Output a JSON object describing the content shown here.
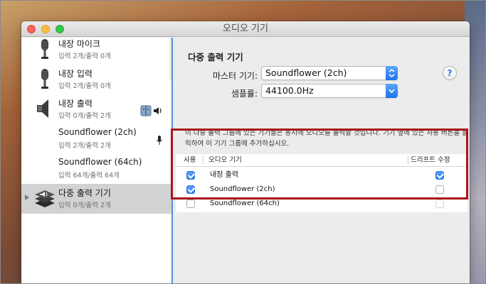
{
  "window": {
    "title": "오디오 기기"
  },
  "sidebar": {
    "devices": [
      {
        "name": "내장 마이크",
        "sub": "입력 2개/출력 0개",
        "icon": "microphone-icon",
        "selected": false
      },
      {
        "name": "내장 입력",
        "sub": "입력 2개/출력 0개",
        "icon": "microphone-icon",
        "selected": false
      },
      {
        "name": "내장 출력",
        "sub": "입력 0개/출력 2개",
        "icon": "speaker-icon",
        "selected": false
      },
      {
        "name": "Soundflower (2ch)",
        "sub": "입력 2개/출력 2개",
        "icon": "",
        "selected": false
      },
      {
        "name": "Soundflower (64ch)",
        "sub": "입력 64개/출력 64개",
        "icon": "",
        "selected": false
      },
      {
        "name": "다중 출력 기기",
        "sub": "입력 0개/출력 2개",
        "icon": "multi-output-icon",
        "selected": true
      }
    ]
  },
  "main": {
    "section_title": "다중 출력 기기",
    "master_label": "마스터 기기:",
    "master_value": "Soundflower (2ch)",
    "rate_label": "샘플률:",
    "rate_value": "44100.0Hz",
    "help": "?",
    "description": "이 다중 출력 그룹에 있는 기기들은 동시에 오디오를 출력할 것입니다. 기기 옆에 있는 사용 버튼을 클릭하여 이 기기 그룹에 추가하십시오.",
    "table": {
      "col_use": "사용",
      "col_device": "오디오 기기",
      "col_drift": "드리프트 수정",
      "rows": [
        {
          "device": "내장 출력",
          "use": true,
          "drift": true
        },
        {
          "device": "Soundflower (2ch)",
          "use": true,
          "drift": false
        },
        {
          "device": "Soundflower (64ch)",
          "use": false,
          "drift": false
        }
      ]
    }
  },
  "colors": {
    "highlight_border": "#a8151d",
    "accent_blue": "#2c7ef0",
    "selection_bg": "#d2d2d2"
  }
}
